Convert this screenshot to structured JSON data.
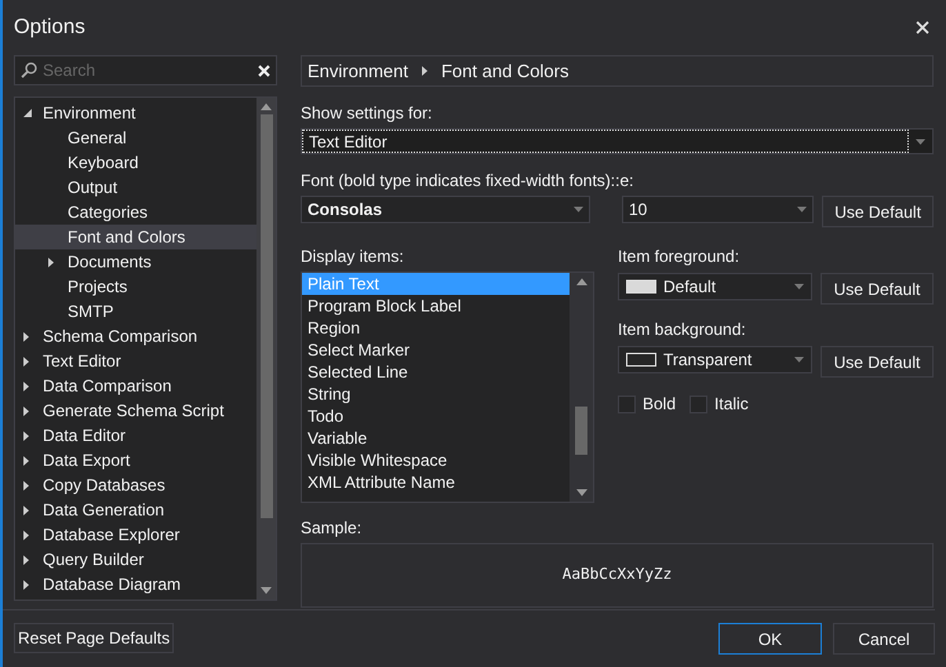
{
  "window": {
    "title": "Options"
  },
  "search": {
    "placeholder": "Search"
  },
  "tree": [
    {
      "label": "Environment",
      "expanded": true,
      "selected": false,
      "children": [
        {
          "label": "General",
          "selected": false
        },
        {
          "label": "Keyboard",
          "selected": false
        },
        {
          "label": "Output",
          "selected": false
        },
        {
          "label": "Categories",
          "selected": false
        },
        {
          "label": "Font and Colors",
          "selected": true
        },
        {
          "label": "Documents",
          "expanded": false,
          "selected": false
        },
        {
          "label": "Projects",
          "selected": false
        },
        {
          "label": "SMTP",
          "selected": false
        }
      ]
    },
    {
      "label": "Schema Comparison",
      "expanded": false,
      "selected": false
    },
    {
      "label": "Text Editor",
      "expanded": false,
      "selected": false
    },
    {
      "label": "Data Comparison",
      "expanded": false,
      "selected": false
    },
    {
      "label": "Generate Schema Script",
      "expanded": false,
      "selected": false
    },
    {
      "label": "Data Editor",
      "expanded": false,
      "selected": false
    },
    {
      "label": "Data Export",
      "expanded": false,
      "selected": false
    },
    {
      "label": "Copy Databases",
      "expanded": false,
      "selected": false
    },
    {
      "label": "Data Generation",
      "expanded": false,
      "selected": false
    },
    {
      "label": "Database Explorer",
      "expanded": false,
      "selected": false
    },
    {
      "label": "Query Builder",
      "expanded": false,
      "selected": false
    },
    {
      "label": "Database Diagram",
      "expanded": false,
      "selected": false
    }
  ],
  "breadcrumb": [
    "Environment",
    "Font and Colors"
  ],
  "show_settings": {
    "label": "Show settings for:",
    "value": "Text Editor"
  },
  "font": {
    "label": "Font (bold type indicates fixed-width fonts)::e:",
    "value": "Consolas",
    "size": "10",
    "button": "Use Default"
  },
  "display_items": {
    "label": "Display items:",
    "items": [
      {
        "label": "Plain Text",
        "selected": true
      },
      {
        "label": "Program Block Label",
        "selected": false
      },
      {
        "label": "Region",
        "selected": false
      },
      {
        "label": "Select Marker",
        "selected": false
      },
      {
        "label": "Selected Line",
        "selected": false
      },
      {
        "label": "String",
        "selected": false
      },
      {
        "label": "Todo",
        "selected": false
      },
      {
        "label": "Variable",
        "selected": false
      },
      {
        "label": "Visible Whitespace",
        "selected": false
      },
      {
        "label": "XML Attribute Name",
        "selected": false
      }
    ]
  },
  "foreground": {
    "label": "Item foreground:",
    "value": "Default",
    "color": "#d9d9d9",
    "button": "Use Default"
  },
  "background": {
    "label": "Item background:",
    "value": "Transparent",
    "color": "#262626",
    "button": "Use Default"
  },
  "checkboxes": [
    {
      "label": "Bold",
      "checked": false
    },
    {
      "label": "Italic",
      "checked": false
    }
  ],
  "sample": {
    "label": "Sample:",
    "text": "AaBbCcXxYyZz"
  },
  "buttons": {
    "reset": "Reset Page Defaults",
    "ok": "OK",
    "cancel": "Cancel"
  }
}
